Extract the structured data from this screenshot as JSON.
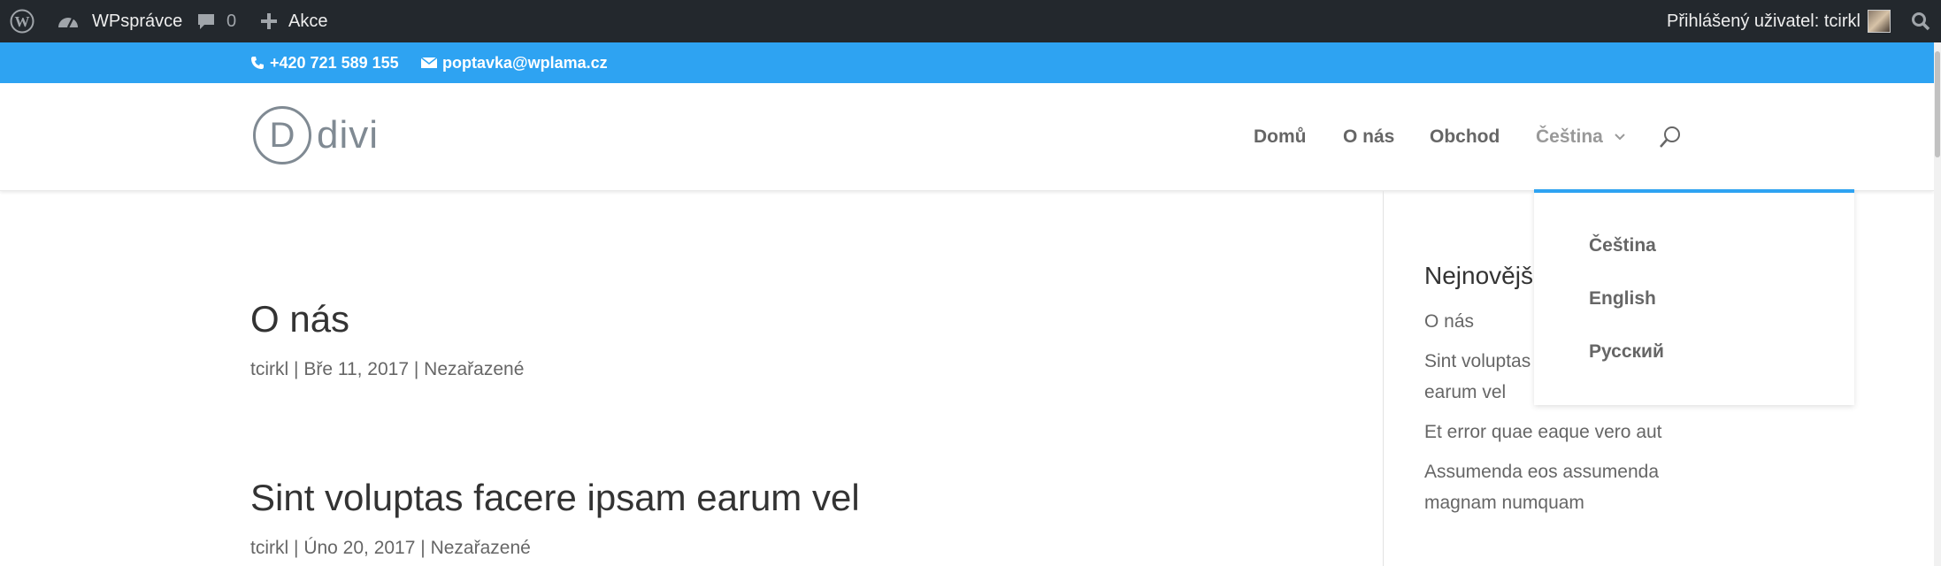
{
  "adminbar": {
    "site_name": "WPsprávce",
    "comments_count": "0",
    "new_label": "Akce",
    "account_label": "Přihlášený uživatel: tcirkl"
  },
  "top_header": {
    "phone": "+420 721 589 155",
    "email": "poptavka@wplama.cz"
  },
  "header": {
    "logo_letter": "D",
    "logo_text": "divi",
    "nav": [
      "Domů",
      "O nás",
      "Obchod",
      "Čeština"
    ]
  },
  "language_dropdown": [
    "Čeština",
    "English",
    "Русский"
  ],
  "posts": [
    {
      "title": "O nás",
      "author": "tcirkl",
      "date": "Bře 11, 2017",
      "category": "Nezařazené"
    },
    {
      "title": "Sint voluptas facere ipsam earum vel",
      "author": "tcirkl",
      "date": "Úno 20, 2017",
      "category": "Nezařazené"
    }
  ],
  "sidebar": {
    "title": "Nejnovějš",
    "links": [
      "O nás",
      "Sint voluptas",
      "earum vel",
      "Et error quae eaque vero aut",
      "Assumenda eos assumenda",
      "magnam numquam"
    ]
  },
  "colors": {
    "adminbar_bg": "#23282d",
    "accent": "#2ea3f2",
    "text": "#666666",
    "heading": "#333333"
  },
  "icons": {
    "wp_logo": "wordpress-icon",
    "site": "dashboard-icon",
    "comments": "comment-icon",
    "new": "plus-icon",
    "search": "search-icon",
    "phone": "phone-icon",
    "email": "envelope-icon",
    "nav_search": "search-icon",
    "lang_chevron": "chevron-down-icon"
  }
}
